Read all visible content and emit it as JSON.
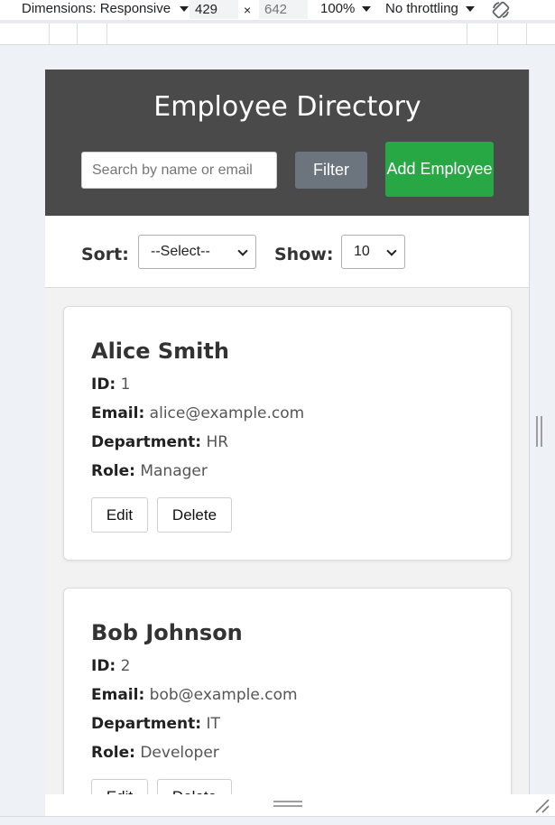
{
  "devtools": {
    "dimensions_label": "Dimensions: Responsive",
    "width_value": "429",
    "height_placeholder": "642",
    "times_sign": "×",
    "zoom": "100%",
    "throttling": "No throttling",
    "icons": [
      "caret-down-icon",
      "rotate-icon",
      "resize-handle-icon",
      "corner-resize-icon"
    ]
  },
  "header": {
    "title": "Employee Directory",
    "search_placeholder": "Search by name or email",
    "filter_label": "Filter",
    "add_label": "Add Employee"
  },
  "controls": {
    "sort_label": "Sort:",
    "sort_value": "--Select--",
    "show_label": "Show:",
    "show_value": "10"
  },
  "employees": [
    {
      "name": "Alice Smith",
      "id_label": "ID:",
      "id": "1",
      "email_label": "Email:",
      "email": "alice@example.com",
      "department_label": "Department:",
      "department": "HR",
      "role_label": "Role:",
      "role": "Manager",
      "edit_label": "Edit",
      "delete_label": "Delete"
    },
    {
      "name": "Bob Johnson",
      "id_label": "ID:",
      "id": "2",
      "email_label": "Email:",
      "email": "bob@example.com",
      "department_label": "Department:",
      "department": "IT",
      "role_label": "Role:",
      "role": "Developer",
      "edit_label": "Edit",
      "delete_label": "Delete"
    }
  ],
  "colors": {
    "header_bg": "#4a4a4a",
    "filter_bg": "#6c757d",
    "add_bg": "#28a745",
    "page_bg": "#f2f2f2"
  }
}
